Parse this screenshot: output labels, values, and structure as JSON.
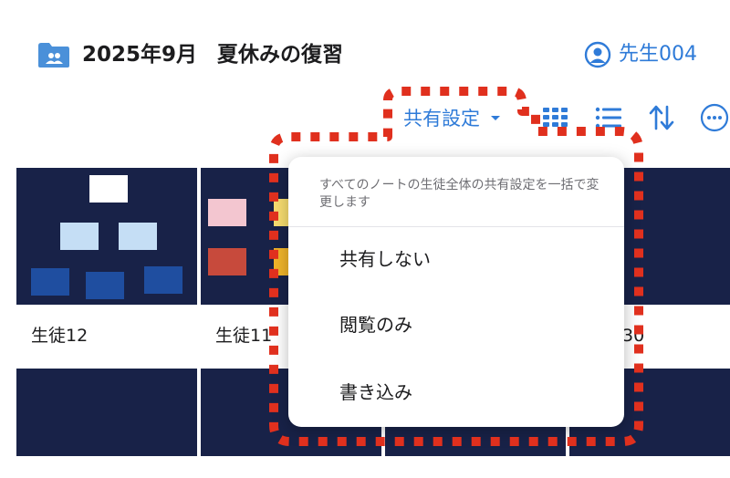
{
  "header": {
    "title_date": "2025年9月",
    "title_name": "夏休みの復習",
    "user_name": "先生004"
  },
  "toolbar": {
    "share_label": "共有設定",
    "icons": [
      "grid-view-icon",
      "list-view-icon",
      "sort-icon",
      "more-icon"
    ]
  },
  "grid": {
    "names": [
      "生徒12",
      "生徒11",
      "30"
    ]
  },
  "share_menu": {
    "description": "すべてのノートの生徒全体の共有設定を一括で変更します",
    "options": [
      "共有しない",
      "閲覧のみ",
      "書き込み"
    ]
  },
  "colors": {
    "accent": "#2f7bd8",
    "tile_background": "#182248",
    "highlight": "#e0301e"
  }
}
